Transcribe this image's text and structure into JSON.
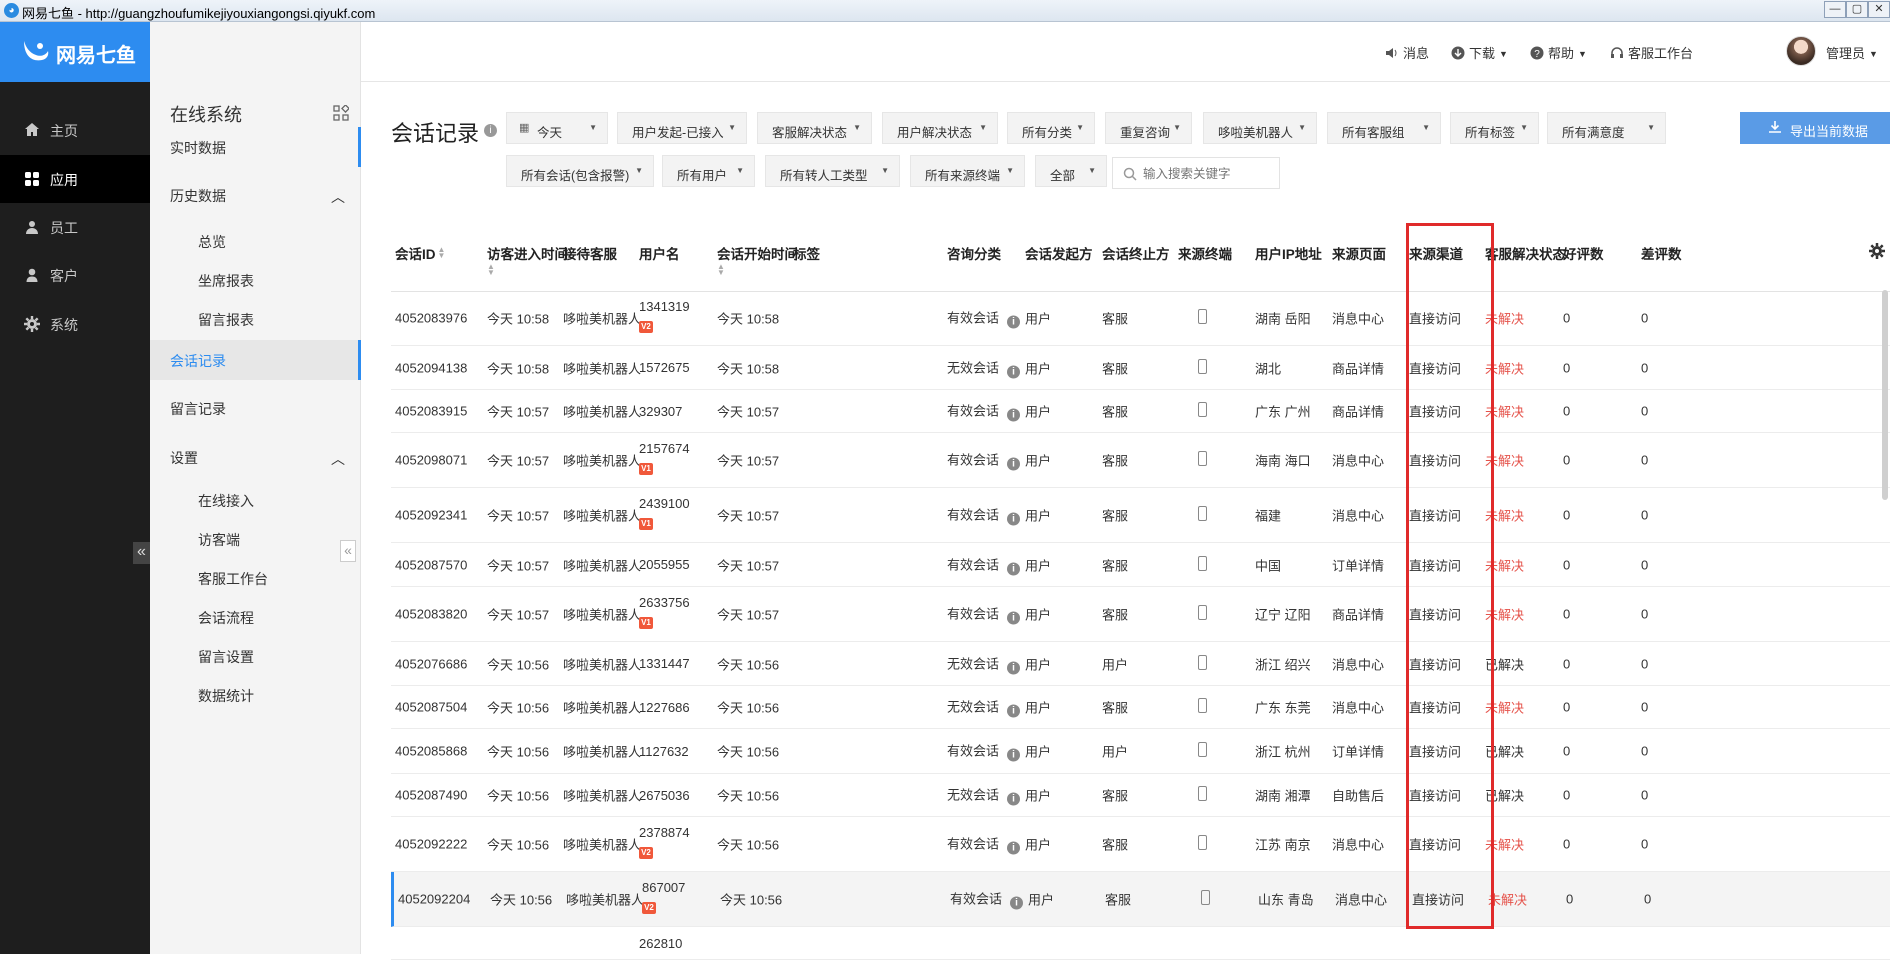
{
  "browser": {
    "title": "网易七鱼 - http://guangzhoufumikejiyouxiangongsi.qiyukf.com",
    "min_btn": "—",
    "max_btn": "▢",
    "close_btn": "✕"
  },
  "leftnav": {
    "logo_text": "网易七鱼",
    "items": [
      {
        "label": "主页",
        "icon": "home-icon"
      },
      {
        "label": "应用",
        "icon": "apps-icon"
      },
      {
        "label": "员工",
        "icon": "staff-icon"
      },
      {
        "label": "客户",
        "icon": "customer-icon"
      },
      {
        "label": "系统",
        "icon": "settings-icon"
      }
    ],
    "active_index": 1,
    "collapse_glyph": "«"
  },
  "subnav": {
    "title": "在线系统",
    "items": [
      {
        "label": "实时数据"
      },
      {
        "label": "历史数据",
        "chevron": "︿"
      },
      {
        "label": "总览"
      },
      {
        "label": "坐席报表"
      },
      {
        "label": "留言报表"
      },
      {
        "label": "会话记录"
      },
      {
        "label": "留言记录"
      },
      {
        "label": "设置",
        "chevron": "︿"
      },
      {
        "label": "在线接入"
      },
      {
        "label": "访客端"
      },
      {
        "label": "客服工作台"
      },
      {
        "label": "会话流程"
      },
      {
        "label": "留言设置"
      },
      {
        "label": "数据统计"
      }
    ],
    "collapse_glyph": "«"
  },
  "header": {
    "messages": "消息",
    "download": "下载",
    "help": "帮助",
    "workbench": "客服工作台",
    "user": "管理员"
  },
  "page": {
    "title": "会话记录",
    "export_label": "导出当前数据",
    "search_placeholder": "输入搜索关键字",
    "filters_row1": [
      "今天",
      "用户发起-已接入",
      "客服解决状态",
      "用户解决状态",
      "所有分类",
      "重复咨询",
      "哆啦美机器人",
      "所有客服组",
      "所有标签",
      "所有满意度"
    ],
    "filters_row2": [
      "所有会话(包含报警)",
      "所有用户",
      "所有转人工类型",
      "所有来源终端",
      "全部"
    ]
  },
  "table": {
    "columns": [
      "会话ID",
      "访客进入时间",
      "接待客服",
      "用户名",
      "会话开始时间",
      "标签",
      "咨询分类",
      "会话发起方",
      "会话终止方",
      "来源终端",
      "用户IP地址",
      "来源页面",
      "来源渠道",
      "客服解决状态",
      "好评数",
      "差评数"
    ],
    "rows": [
      {
        "id": "4052083976",
        "enter": "今天 10:58",
        "agent": "哆啦美机器人",
        "user": "1341319",
        "badge": "V2",
        "start": "今天 10:58",
        "category": "有效会话",
        "initiator": "用户",
        "terminator": "客服",
        "ip": "湖南 岳阳",
        "page": "消息中心",
        "channel": "直接访问",
        "status": "未解决",
        "good": "0",
        "bad": "0"
      },
      {
        "id": "4052094138",
        "enter": "今天 10:58",
        "agent": "哆啦美机器人",
        "user": "1572675",
        "badge": "",
        "start": "今天 10:58",
        "category": "无效会话",
        "initiator": "用户",
        "terminator": "客服",
        "ip": "湖北",
        "page": "商品详情",
        "channel": "直接访问",
        "status": "未解决",
        "good": "0",
        "bad": "0"
      },
      {
        "id": "4052083915",
        "enter": "今天 10:57",
        "agent": "哆啦美机器人",
        "user": "329307",
        "badge": "",
        "start": "今天 10:57",
        "category": "有效会话",
        "initiator": "用户",
        "terminator": "客服",
        "ip": "广东 广州",
        "page": "商品详情",
        "channel": "直接访问",
        "status": "未解决",
        "good": "0",
        "bad": "0"
      },
      {
        "id": "4052098071",
        "enter": "今天 10:57",
        "agent": "哆啦美机器人",
        "user": "2157674",
        "badge": "V1",
        "start": "今天 10:57",
        "category": "有效会话",
        "initiator": "用户",
        "terminator": "客服",
        "ip": "海南 海口",
        "page": "消息中心",
        "channel": "直接访问",
        "status": "未解决",
        "good": "0",
        "bad": "0"
      },
      {
        "id": "4052092341",
        "enter": "今天 10:57",
        "agent": "哆啦美机器人",
        "user": "2439100",
        "badge": "V1",
        "start": "今天 10:57",
        "category": "有效会话",
        "initiator": "用户",
        "terminator": "客服",
        "ip": "福建",
        "page": "消息中心",
        "channel": "直接访问",
        "status": "未解决",
        "good": "0",
        "bad": "0"
      },
      {
        "id": "4052087570",
        "enter": "今天 10:57",
        "agent": "哆啦美机器人",
        "user": "2055955",
        "badge": "",
        "start": "今天 10:57",
        "category": "有效会话",
        "initiator": "用户",
        "terminator": "客服",
        "ip": "中国",
        "page": "订单详情",
        "channel": "直接访问",
        "status": "未解决",
        "good": "0",
        "bad": "0"
      },
      {
        "id": "4052083820",
        "enter": "今天 10:57",
        "agent": "哆啦美机器人",
        "user": "2633756",
        "badge": "V1",
        "start": "今天 10:57",
        "category": "有效会话",
        "initiator": "用户",
        "terminator": "客服",
        "ip": "辽宁 辽阳",
        "page": "商品详情",
        "channel": "直接访问",
        "status": "未解决",
        "good": "0",
        "bad": "0"
      },
      {
        "id": "4052076686",
        "enter": "今天 10:56",
        "agent": "哆啦美机器人",
        "user": "1331447",
        "badge": "",
        "start": "今天 10:56",
        "category": "无效会话",
        "initiator": "用户",
        "terminator": "用户",
        "ip": "浙江 绍兴",
        "page": "消息中心",
        "channel": "直接访问",
        "status": "已解决",
        "good": "0",
        "bad": "0"
      },
      {
        "id": "4052087504",
        "enter": "今天 10:56",
        "agent": "哆啦美机器人",
        "user": "1227686",
        "badge": "",
        "start": "今天 10:56",
        "category": "无效会话",
        "initiator": "用户",
        "terminator": "客服",
        "ip": "广东 东莞",
        "page": "消息中心",
        "channel": "直接访问",
        "status": "未解决",
        "good": "0",
        "bad": "0"
      },
      {
        "id": "4052085868",
        "enter": "今天 10:56",
        "agent": "哆啦美机器人",
        "user": "1127632",
        "badge": "",
        "start": "今天 10:56",
        "category": "有效会话",
        "initiator": "用户",
        "terminator": "用户",
        "ip": "浙江 杭州",
        "page": "订单详情",
        "channel": "直接访问",
        "status": "已解决",
        "good": "0",
        "bad": "0"
      },
      {
        "id": "4052087490",
        "enter": "今天 10:56",
        "agent": "哆啦美机器人",
        "user": "2675036",
        "badge": "",
        "start": "今天 10:56",
        "category": "无效会话",
        "initiator": "用户",
        "terminator": "客服",
        "ip": "湖南 湘潭",
        "page": "自助售后",
        "channel": "直接访问",
        "status": "已解决",
        "good": "0",
        "bad": "0"
      },
      {
        "id": "4052092222",
        "enter": "今天 10:56",
        "agent": "哆啦美机器人",
        "user": "2378874",
        "badge": "V2",
        "start": "今天 10:56",
        "category": "有效会话",
        "initiator": "用户",
        "terminator": "客服",
        "ip": "江苏 南京",
        "page": "消息中心",
        "channel": "直接访问",
        "status": "未解决",
        "good": "0",
        "bad": "0"
      },
      {
        "id": "4052092204",
        "enter": "今天 10:56",
        "agent": "哆啦美机器人",
        "user": "867007",
        "badge": "V2",
        "start": "今天 10:56",
        "category": "有效会话",
        "initiator": "用户",
        "terminator": "客服",
        "ip": "山东 青岛",
        "page": "消息中心",
        "channel": "直接访问",
        "status": "未解决",
        "good": "0",
        "bad": "0"
      },
      {
        "id": "",
        "enter": "",
        "agent": "",
        "user": "262810",
        "badge": "",
        "start": "",
        "category": "",
        "initiator": "",
        "terminator": "",
        "ip": "",
        "page": "",
        "channel": "",
        "status": "",
        "good": "",
        "bad": ""
      }
    ],
    "hover_row_index": 12
  },
  "colors": {
    "accent": "#2d8cf0",
    "unsolved": "#e5534b",
    "highlight": "#e02a2a",
    "leftnav_bg": "#1e1e1e"
  }
}
